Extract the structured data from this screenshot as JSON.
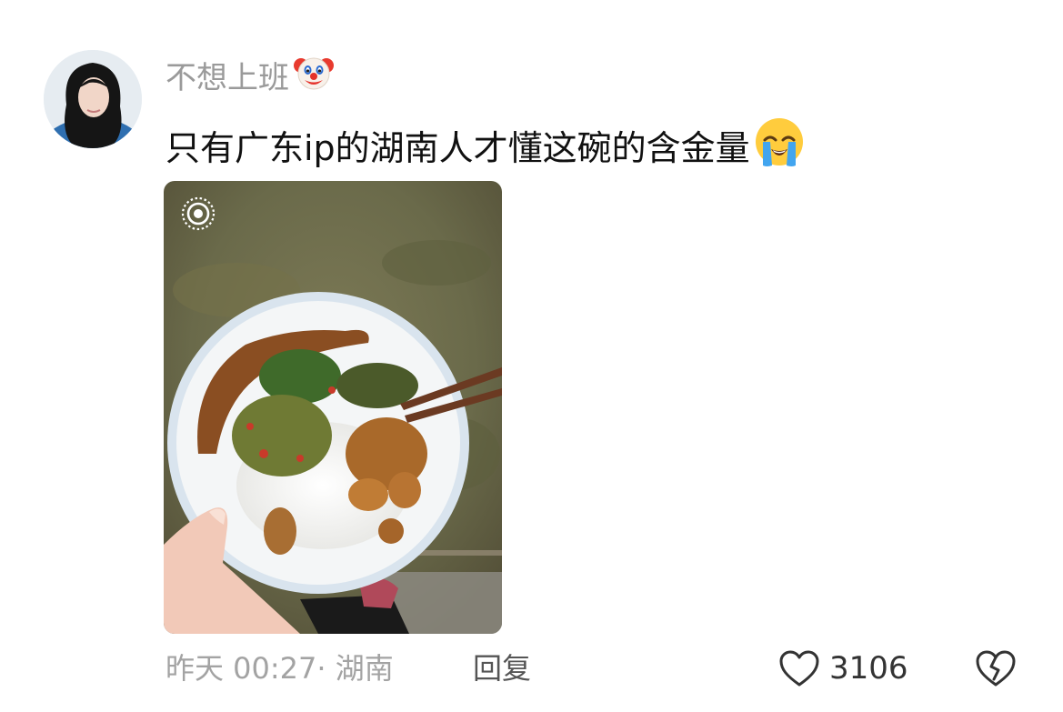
{
  "comment": {
    "username": "不想上班",
    "username_emoji": "clown-face-emoji",
    "text": "只有广东ip的湖南人才懂这碗的含金量",
    "text_emoji": "loudly-crying-face-emoji",
    "photo_badge_icon": "live-photo-icon",
    "meta": "昨天 00:27· 湖南",
    "reply_label": "回复",
    "like_count": "3106",
    "like_icon": "heart-outline-icon",
    "dislike_icon": "broken-heart-outline-icon"
  },
  "colors": {
    "username": "#9a9a9a",
    "text": "#111111",
    "meta": "#a3a3a3",
    "reply": "#555555",
    "icons": "#333333"
  }
}
